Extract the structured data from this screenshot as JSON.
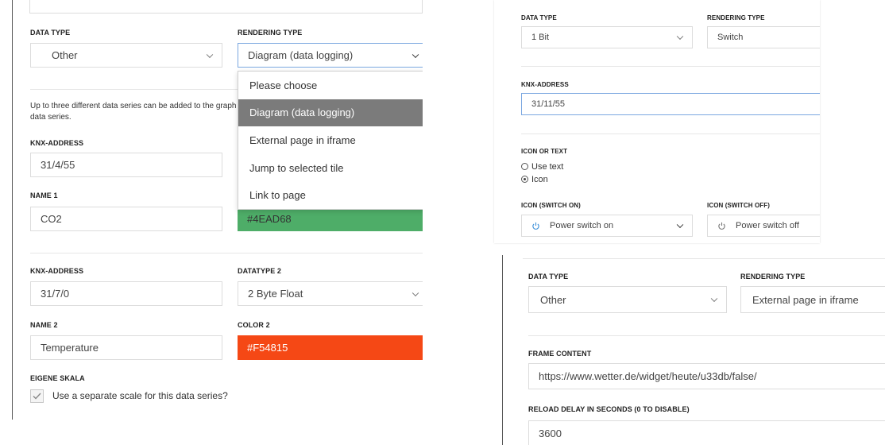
{
  "left": {
    "data_type_label": "DATA TYPE",
    "data_type_value": "Other",
    "rendering_type_label": "RENDERING TYPE",
    "rendering_type_value": "Diagram (data logging)",
    "dropdown_options": [
      "Please choose",
      "Diagram (data logging)",
      "External page in iframe",
      "Jump to selected tile",
      "Link to page"
    ],
    "dropdown_selected_index": 1,
    "info_line1": "Up to three different data series can be added to the graph",
    "info_line2": "data series.",
    "knx1_label": "KNX-ADDRESS",
    "knx1_value": "31/4/55",
    "name1_label": "NAME 1",
    "name1_value": "CO2",
    "color1_value": "#4EAD68",
    "color1_hex": "#4EAD68",
    "knx2_label": "KNX-ADDRESS",
    "knx2_value": "31/7/0",
    "datatype2_label": "DATATYPE 2",
    "datatype2_value": "2 Byte Float",
    "name2_label": "NAME 2",
    "name2_value": "Temperature",
    "color2_label": "COLOR 2",
    "color2_value": "#F54815",
    "color2_hex": "#F54815",
    "scale_label": "EIGENE SKALA",
    "scale_checkbox_text": "Use a separate scale for this data series?",
    "scale_checked": true
  },
  "top_right": {
    "data_type_label": "DATA TYPE",
    "data_type_value": "1 Bit",
    "rendering_type_label": "RENDERING TYPE",
    "rendering_type_value": "Switch",
    "knx_label": "KNX-ADDRESS",
    "knx_value": "31/11/55",
    "icon_or_text_label": "ICON OR TEXT",
    "radio_options": [
      "Use text",
      "Icon"
    ],
    "radio_selected_index": 1,
    "icon_on_label": "ICON (SWITCH ON)",
    "icon_on_value": "Power switch on",
    "icon_off_label": "ICON (SWITCH OFF)",
    "icon_off_value": "Power switch off",
    "icon_color": "#3a8fd9"
  },
  "bottom_right": {
    "data_type_label": "DATA TYPE",
    "data_type_value": "Other",
    "rendering_type_label": "RENDERING TYPE",
    "rendering_type_value": "External page in iframe",
    "frame_content_label": "FRAME CONTENT",
    "frame_content_value": "https://www.wetter.de/widget/heute/u33db/false/",
    "reload_label": "RELOAD DELAY IN SECONDS (0 TO DISABLE)",
    "reload_value": "3600"
  }
}
